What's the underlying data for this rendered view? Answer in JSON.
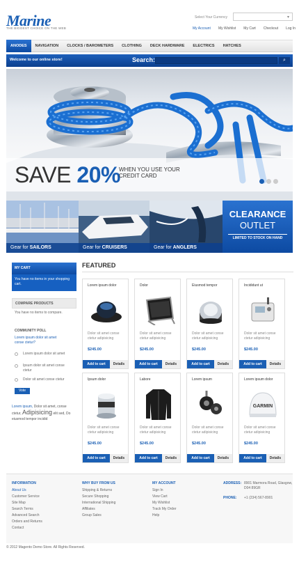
{
  "header": {
    "logo": "Marine",
    "tagline": "THE BIGGEST CHOICE ON THE WEB",
    "currency_label": "Select Your Currency",
    "currency_value": "",
    "toplinks": [
      "My Account",
      "My Wishlist",
      "My Cart",
      "Checkout",
      "Log In"
    ]
  },
  "nav": {
    "items": [
      "ANODES",
      "NAVIGATION",
      "CLOCKS / BAROMETERS",
      "CLOTHING",
      "DECK HARDWARE",
      "ELECTRICS",
      "HATCHES"
    ],
    "active": 0,
    "welcome": "Welcome to our online store!",
    "search_label": "Search:",
    "search_placeholder": ""
  },
  "banner": {
    "save_text": "SAVE",
    "save_percent": "20%",
    "save_sub": "WHEN YOU USE YOUR CREDIT CARD",
    "dots_total": 3,
    "dots_active": 0
  },
  "promos": [
    {
      "prefix": "Gear for",
      "name": "SAILORS"
    },
    {
      "prefix": "Gear for",
      "name": "CRUISERS"
    },
    {
      "prefix": "Gear for",
      "name": "ANGLERS"
    }
  ],
  "clearance": {
    "line1": "CLEARANCE",
    "line2": "OUTLET",
    "line3": "LIMITED TO STOCK ON HAND"
  },
  "sidebar": {
    "cart_title": "MY CART",
    "cart_text": "You have no items in your shopping cart.",
    "compare_title": "COMPARE PRODUCTS",
    "compare_text": "You have no items to compare.",
    "poll_title": "COMMUNITY POLL",
    "poll_question": "Lorem ipsum dolor sit amet conse ctetur?",
    "poll_options": [
      "Lorem ipsum dolor sit amet",
      "Ipsum dolor sit amet conse ctetur",
      "Dolor sit amet conse ctetur"
    ],
    "vote_label": "Vote",
    "tags_line1": "Lorem ipsum,",
    "tags_line1b": "Dolor sit amet, conse",
    "tags_line2": "ctetur,",
    "tags_big": "Adipisicing",
    "tags_line2b": "elit sed, Do",
    "tags_line3": "eiusmod tempor incidid"
  },
  "featured": {
    "title": "FEATURED",
    "add_label": "Add to cart",
    "details_label": "Details",
    "products": [
      {
        "name": "Lorem ipsum dolor",
        "desc": "Dolor sit amet conse ctetur adipisicing",
        "price": "$245.00"
      },
      {
        "name": "Dolor",
        "desc": "Dolor sit amet conse ctetur adipisicing",
        "price": "$245.00"
      },
      {
        "name": "Eiusmod tempor",
        "desc": "Dolor sit amet conse ctetur adipisicing",
        "price": "$245.00"
      },
      {
        "name": "Incididunt ut",
        "desc": "Dolor sit amet conse ctetur adipisicing",
        "price": "$245.00"
      },
      {
        "name": "Ipsum dolor",
        "desc": "Dolor sit amet conse ctetur adipisicing",
        "price": "$245.00"
      },
      {
        "name": "Labore",
        "desc": "Dolor sit amet conse ctetur adipisicing",
        "price": "$245.00"
      },
      {
        "name": "Lorem ipsum",
        "desc": "Dolor sit amet conse ctetur adipisicing",
        "price": "$245.00"
      },
      {
        "name": "Lorem ipsum dolor",
        "desc": "Dolor sit amet conse ctetur adipisicing",
        "price": "$245.00"
      }
    ]
  },
  "footer": {
    "info_title": "INFORMATION",
    "info_links": [
      "About Us",
      "Customer Service",
      "Site Map",
      "Search Terms",
      "Advanced Search",
      "Orders and Returns",
      "Contact"
    ],
    "why_title": "WHY BUY FROM US",
    "why_links": [
      "Shipping & Returns",
      "Secure Shopping",
      "International Shipping",
      "Affiliates",
      "Group Sales"
    ],
    "account_title": "MY ACCOUNT",
    "account_links": [
      "Sign In",
      "View Cart",
      "My Wishlist",
      "Track My Order",
      "Help"
    ],
    "address_label": "ADDRESS:",
    "address_value": "8901 Marmora Road, Glasgow, D04 89GR",
    "phone_label": "PHONE:",
    "phone_value": "+1 (234) 567-8901",
    "copyright": "© 2012 Magento Demo Store. All Rights Reserved."
  },
  "colors": {
    "accent": "#1a5fb4",
    "dark_blue": "#0c3f8e"
  }
}
